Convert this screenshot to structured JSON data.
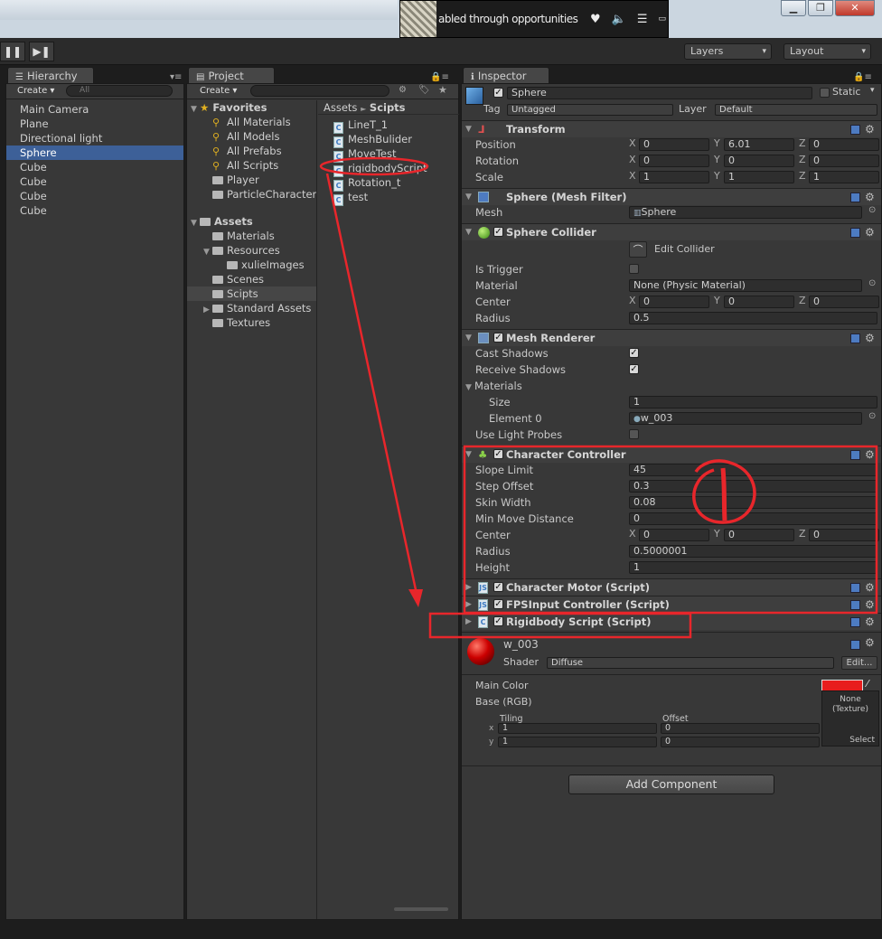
{
  "notification": {
    "text": "abled through opportunities"
  },
  "toolbar": {
    "layers": "Layers",
    "layout": "Layout",
    "pause": "❚❚",
    "step": "▶❚"
  },
  "hierarchy": {
    "title": "Hierarchy",
    "create": "Create ▾",
    "search_placeholder": "All",
    "items": [
      {
        "label": "Main Camera",
        "selected": false
      },
      {
        "label": "Plane",
        "selected": false
      },
      {
        "label": "Directional light",
        "selected": false
      },
      {
        "label": "Sphere",
        "selected": true
      },
      {
        "label": "Cube",
        "selected": false
      },
      {
        "label": "Cube",
        "selected": false
      },
      {
        "label": "Cube",
        "selected": false
      },
      {
        "label": "Cube",
        "selected": false
      }
    ]
  },
  "project": {
    "title": "Project",
    "create": "Create ▾",
    "favorites_label": "Favorites",
    "favorites": [
      "All Materials",
      "All Models",
      "All Prefabs",
      "All Scripts",
      "Player",
      "ParticleCharacter"
    ],
    "assets_label": "Assets",
    "assets": [
      "Materials",
      "Resources",
      "xulieImages",
      "Scenes",
      "Scipts",
      "Standard Assets",
      "Textures"
    ],
    "breadcrumb": [
      "Assets",
      "Scipts"
    ],
    "files": [
      "LineT_1",
      "MeshBulider",
      "MoveTest",
      "rigidbodyScript",
      "Rotation_t",
      "test"
    ]
  },
  "inspector": {
    "title": "Inspector",
    "object_name": "Sphere",
    "static": "Static",
    "tag_label": "Tag",
    "tag_value": "Untagged",
    "layer_label": "Layer",
    "layer_value": "Default",
    "transform": {
      "title": "Transform",
      "position_label": "Position",
      "rotation_label": "Rotation",
      "scale_label": "Scale",
      "position": [
        "0",
        "6.01",
        "0"
      ],
      "rotation": [
        "0",
        "0",
        "0"
      ],
      "scale": [
        "1",
        "1",
        "1"
      ]
    },
    "mesh_filter": {
      "title": "Sphere (Mesh Filter)",
      "mesh_label": "Mesh",
      "mesh_value": "Sphere"
    },
    "collider": {
      "title": "Sphere Collider",
      "edit_label": "Edit Collider",
      "trigger_label": "Is Trigger",
      "material_label": "Material",
      "material_value": "None (Physic Material)",
      "center_label": "Center",
      "center": [
        "0",
        "0",
        "0"
      ],
      "radius_label": "Radius",
      "radius": "0.5"
    },
    "renderer": {
      "title": "Mesh Renderer",
      "cast_label": "Cast Shadows",
      "receive_label": "Receive Shadows",
      "materials_label": "Materials",
      "size_label": "Size",
      "size": "1",
      "element_label": "Element 0",
      "element_value": "w_003",
      "probes_label": "Use Light Probes"
    },
    "controller": {
      "title": "Character Controller",
      "slope_label": "Slope Limit",
      "slope": "45",
      "step_label": "Step Offset",
      "step": "0.3",
      "skin_label": "Skin Width",
      "skin": "0.08",
      "minmove_label": "Min Move Distance",
      "minmove": "0",
      "center_label": "Center",
      "center": [
        "0",
        "0",
        "0"
      ],
      "radius_label": "Radius",
      "radius": "0.5000001",
      "height_label": "Height",
      "height": "1"
    },
    "motor": {
      "title": "Character Motor (Script)"
    },
    "fps": {
      "title": "FPSInput Controller (Script)"
    },
    "rigidbody": {
      "title": "Rigidbody Script (Script)"
    },
    "material": {
      "name": "w_003",
      "shader_label": "Shader",
      "shader_value": "Diffuse",
      "edit": "Edit...",
      "main_color_label": "Main Color",
      "main_color": "#e81d1d",
      "base_label": "Base (RGB)",
      "tiling_label": "Tiling",
      "offset_label": "Offset",
      "tiling": [
        "1",
        "1"
      ],
      "offset": [
        "0",
        "0"
      ],
      "texture_none": "None (Texture)",
      "select": "Select"
    },
    "add_component": "Add Component"
  },
  "colors": {
    "annotation": "#e8262b",
    "selection": "#3d6098"
  }
}
